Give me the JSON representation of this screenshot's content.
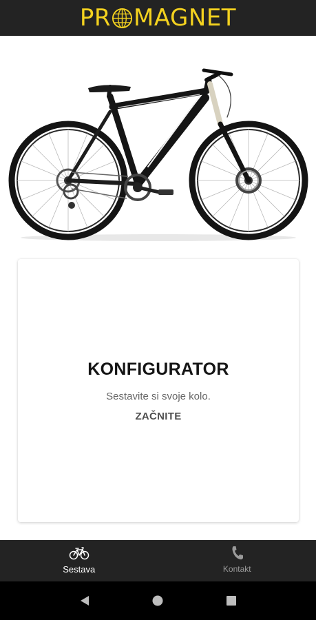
{
  "app_bar": {
    "logo_left": "PR",
    "logo_right": "MAGNET",
    "logo_globe_icon": "globe-icon",
    "brand_color": "#f4d21f",
    "background": "#232323"
  },
  "hero": {
    "image": "mountain-bike-photo"
  },
  "card": {
    "title": "KONFIGURATOR",
    "subtitle": "Sestavite si svoje kolo.",
    "cta_label": "ZAČNITE"
  },
  "bottom_nav": {
    "items": [
      {
        "label": "Sestava",
        "icon": "bicycle-icon",
        "active": true
      },
      {
        "label": "Kontakt",
        "icon": "phone-icon",
        "active": false
      }
    ]
  },
  "system_nav": {
    "buttons": [
      "back-icon",
      "home-icon",
      "recents-icon"
    ]
  }
}
